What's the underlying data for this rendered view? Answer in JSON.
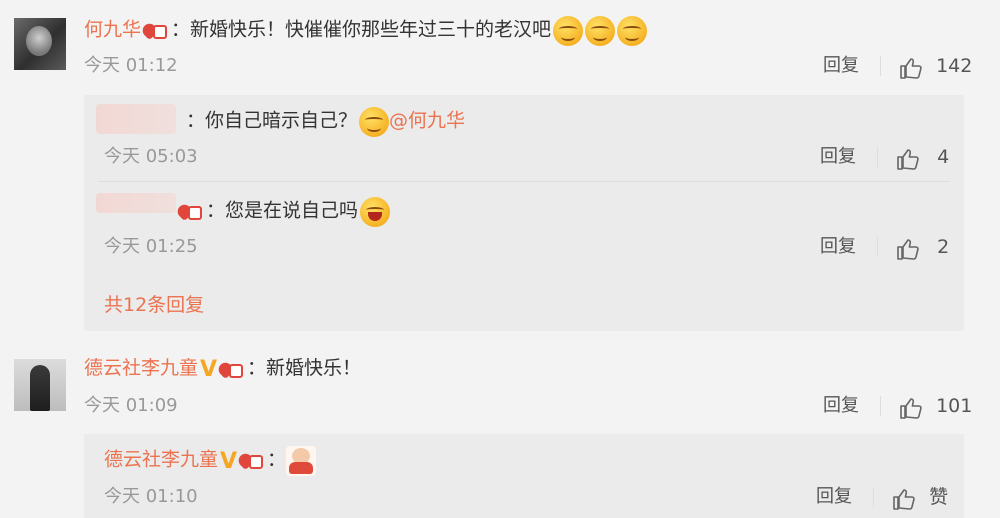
{
  "comments": [
    {
      "user": "何九华",
      "text": "：新婚快乐！快催催你那些年过三十的老汉吧",
      "time": "今天 01:12",
      "reply_label": "回复",
      "likes": "142",
      "replies": [
        {
          "user": "",
          "text": "：你自己暗示自己？",
          "mention": "@何九华",
          "time": "今天 05:03",
          "reply_label": "回复",
          "likes": "4"
        },
        {
          "user": "",
          "text": "：您是在说自己吗",
          "time": "今天 01:25",
          "reply_label": "回复",
          "likes": "2"
        }
      ],
      "more_replies": "共12条回复"
    },
    {
      "user": "德云社李九童",
      "text": "：新婚快乐！",
      "time": "今天 01:09",
      "reply_label": "回复",
      "likes": "101",
      "replies": [
        {
          "user": "德云社李九童",
          "text": "：",
          "time": "今天 01:10",
          "reply_label": "回复",
          "likes": "赞"
        }
      ]
    }
  ],
  "colors": {
    "username": "#eb7350",
    "vip_red": "#e0463c",
    "verified": "#f5a623",
    "background": "#f3f3f3",
    "reply_bg": "#ebebeb"
  }
}
